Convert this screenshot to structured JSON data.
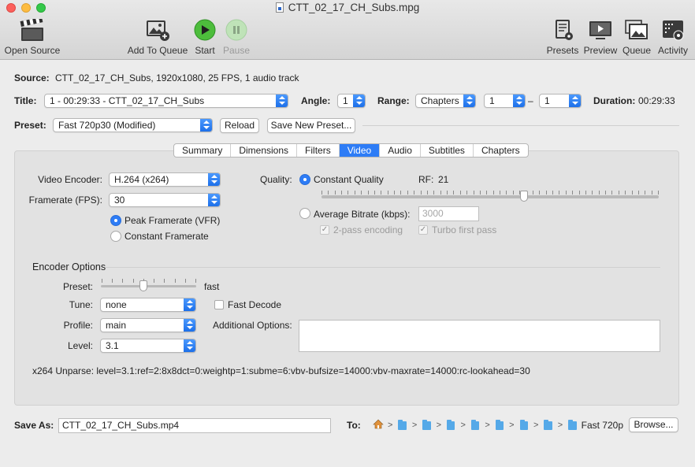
{
  "window": {
    "title": "CTT_02_17_CH_Subs.mpg"
  },
  "toolbar": {
    "open_source": "Open Source",
    "add_to_queue": "Add To Queue",
    "start": "Start",
    "pause": "Pause",
    "presets": "Presets",
    "preview": "Preview",
    "queue": "Queue",
    "activity": "Activity"
  },
  "source": {
    "label": "Source:",
    "value": "CTT_02_17_CH_Subs, 1920x1080, 25 FPS, 1 audio track"
  },
  "title_row": {
    "label": "Title:",
    "value": "1 - 00:29:33 - CTT_02_17_CH_Subs",
    "angle_label": "Angle:",
    "angle_value": "1",
    "range_label": "Range:",
    "range_type": "Chapters",
    "range_start": "1",
    "range_dash": "–",
    "range_end": "1",
    "duration_label": "Duration:",
    "duration_value": "00:29:33"
  },
  "preset_row": {
    "label": "Preset:",
    "value": "Fast 720p30 (Modified)",
    "reload": "Reload",
    "save_new": "Save New Preset..."
  },
  "tabs": [
    "Summary",
    "Dimensions",
    "Filters",
    "Video",
    "Audio",
    "Subtitles",
    "Chapters"
  ],
  "active_tab": "Video",
  "video": {
    "encoder_label": "Video Encoder:",
    "encoder_value": "H.264 (x264)",
    "framerate_label": "Framerate (FPS):",
    "framerate_value": "30",
    "peak_framerate": "Peak Framerate (VFR)",
    "constant_framerate": "Constant Framerate",
    "quality_label": "Quality:",
    "constant_quality": "Constant Quality",
    "rf_label": "RF:",
    "rf_value": "21",
    "rf_slider_fraction": 0.6,
    "average_bitrate": "Average Bitrate (kbps):",
    "bitrate_placeholder": "3000",
    "two_pass": "2-pass encoding",
    "turbo_first_pass": "Turbo first pass"
  },
  "encoder_options": {
    "heading": "Encoder Options",
    "preset_label": "Preset:",
    "preset_value": "fast",
    "preset_slider_fraction": 0.45,
    "tune_label": "Tune:",
    "tune_value": "none",
    "fast_decode": "Fast Decode",
    "profile_label": "Profile:",
    "profile_value": "main",
    "additional_label": "Additional Options:",
    "additional_value": "",
    "level_label": "Level:",
    "level_value": "3.1",
    "unparse": "x264 Unparse: level=3.1:ref=2:8x8dct=0:weightp=1:subme=6:vbv-bufsize=14000:vbv-maxrate=14000:rc-lookahead=30"
  },
  "save": {
    "label": "Save As:",
    "value": "CTT_02_17_CH_Subs.mp4",
    "to_label": "To:",
    "last_folder": "Fast 720p",
    "browse": "Browse..."
  },
  "colors": {
    "accent": "#2d7cf6",
    "start_green": "#3fb534"
  }
}
